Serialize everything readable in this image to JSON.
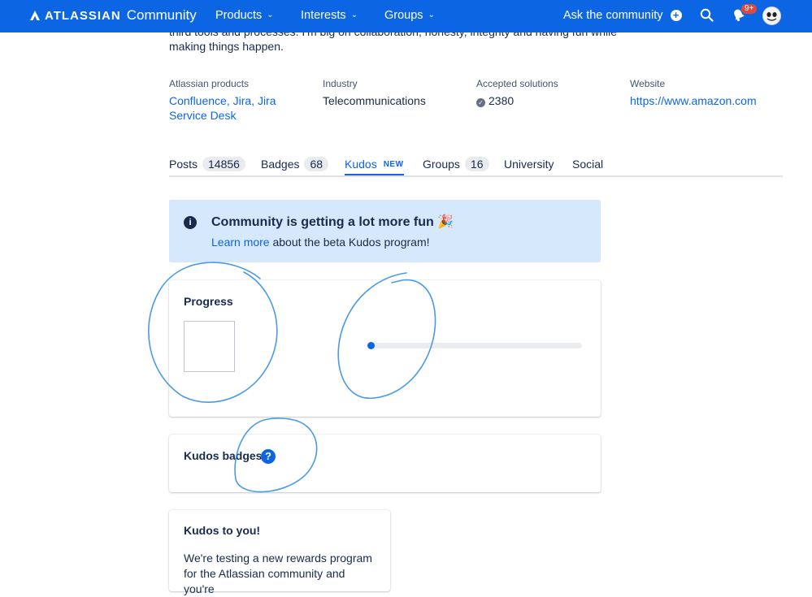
{
  "header": {
    "brand": "ATLASSIAN",
    "brand_sub": "Community",
    "nav": [
      {
        "label": "Products"
      },
      {
        "label": "Interests"
      },
      {
        "label": "Groups"
      }
    ],
    "ask_label": "Ask the community",
    "notifications_count": "9+",
    "bar_color": "#0c66e4"
  },
  "profile": {
    "bio_line1": "third tools and processes. I'm big on collaboration, honesty, integrity and having fun while",
    "bio_line2": "making things happen.",
    "products_label": "Atlassian products",
    "products_value": "Confluence, Jira, Jira Service Desk",
    "industry_label": "Industry",
    "industry_value": "Telecommunications",
    "solutions_label": "Accepted solutions",
    "solutions_value": "2380",
    "website_label": "Website",
    "website_value": "https://www.amazon.com"
  },
  "tabs": [
    {
      "label": "Posts",
      "count": "14856"
    },
    {
      "label": "Badges",
      "count": "68"
    },
    {
      "label": "Kudos",
      "badge": "NEW",
      "active": true
    },
    {
      "label": "Groups",
      "count": "16"
    },
    {
      "label": "University"
    },
    {
      "label": "Social"
    }
  ],
  "banner": {
    "title": "Community is getting a lot more fun 🎉",
    "link": "Learn more",
    "body": " about the beta Kudos program!"
  },
  "progress_card": {
    "title": "Progress",
    "progress_fraction": 0.0
  },
  "badges_card": {
    "title": "Kudos badges"
  },
  "kudos_card": {
    "title": "Kudos to you!",
    "text": "We're testing a new rewards program for the Atlassian community and you're"
  },
  "icons": {
    "search": "search-icon",
    "notifications": "bell-icon",
    "add": "plus-circle-icon",
    "info": "info-icon",
    "help": "question-icon"
  }
}
